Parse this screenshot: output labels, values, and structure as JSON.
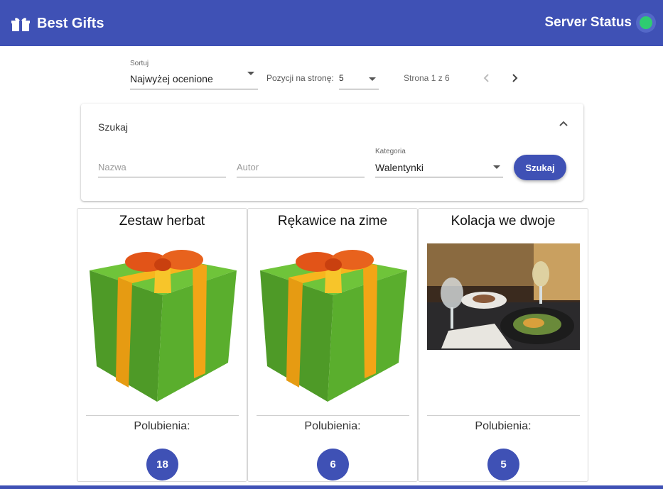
{
  "header": {
    "title": "Best Gifts",
    "logo_icon": "gift-icon",
    "status_label": "Server Status",
    "status_color": "#2ecc71",
    "brand_color": "#3f51b5"
  },
  "toolbar": {
    "sort_caption": "Sortuj",
    "sort_value": "Najwyżej ocenione",
    "per_page_label": "Pozycji na stronę:",
    "per_page_value": "5",
    "page_info": "Strona 1 z 6",
    "prev_icon": "chevron-left-icon",
    "next_icon": "chevron-right-icon"
  },
  "search": {
    "title": "Szukaj",
    "name_placeholder": "Nazwa",
    "author_placeholder": "Autor",
    "category_caption": "Kategoria",
    "category_value": "Walentynki",
    "button_label": "Szukaj"
  },
  "cards": [
    {
      "title": "Zestaw herbat",
      "image": "gift-box-image",
      "likes_label": "Polubienia:",
      "likes": "18"
    },
    {
      "title": "Rękawice na zime",
      "image": "gift-box-image",
      "likes_label": "Polubienia:",
      "likes": "6"
    },
    {
      "title": "Kolacja we dwoje",
      "image": "dinner-photo",
      "likes_label": "Polubienia:",
      "likes": "5"
    }
  ]
}
